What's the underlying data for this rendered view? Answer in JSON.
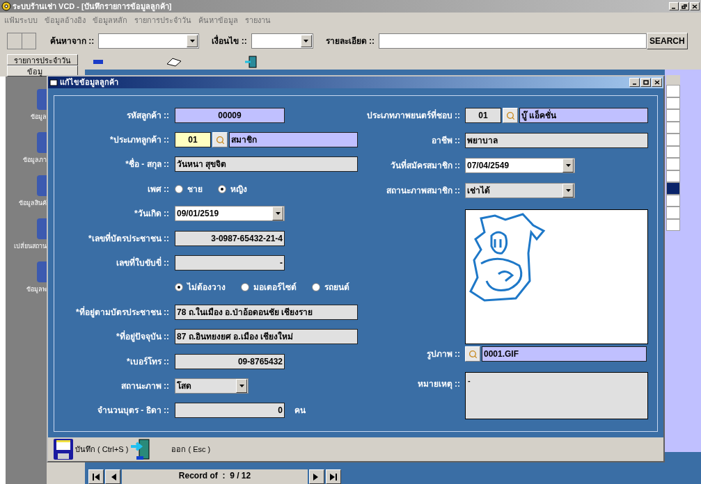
{
  "window": {
    "title": "ระบบร้านเช่า VCD - [บันทึกรายการข้อมูลลูกค้า]"
  },
  "menu": [
    "แฟ้มระบบ",
    "ข้อมูลอ้างอิง",
    "ข้อมูลหลัก",
    "รายการประจำวัน",
    "ค้นหาข้อมูล",
    "รายงาน"
  ],
  "toolbar": {
    "search_from_label": "ค้นหาจาก ::",
    "condition_label": "เงื่อนไข ::",
    "detail_label": "รายละเอียด ::",
    "search_button": "SEARCH"
  },
  "side_tabs": [
    {
      "label": "รายการประจำวัน",
      "selected": false
    },
    {
      "label": "ข้อมู",
      "selected": true
    }
  ],
  "sidebar": {
    "items": [
      "ข้อมูล",
      "ข้อมูลภา",
      "ข้อมูลสินค้",
      "เปลี่ยนสถาน",
      "ข้อมูลพ"
    ]
  },
  "grid": {
    "rows": [
      {
        "selected": false
      },
      {
        "selected": false
      },
      {
        "selected": false
      },
      {
        "selected": false
      },
      {
        "selected": false
      },
      {
        "selected": false
      },
      {
        "selected": false
      },
      {
        "selected": false
      },
      {
        "selected": true
      },
      {
        "selected": false
      },
      {
        "selected": false
      },
      {
        "selected": false
      }
    ]
  },
  "dialog": {
    "title": "แก้ไขข้อมูลลูกค้า",
    "left_fields": [
      {
        "kind": "code",
        "label": "รหัสลูกค้า ::",
        "value": "00009",
        "readonly": true
      },
      {
        "kind": "lookup",
        "label": "*ประเภทลูกค้า ::",
        "code": "01",
        "value": "สมาชิก",
        "focused": true
      },
      {
        "kind": "text",
        "label": "*ชื่อ - สกุล ::",
        "value": "วันหนา สุขจิต"
      },
      {
        "kind": "radio",
        "label": "เพศ ::",
        "options": [
          {
            "label": "ชาย",
            "selected": false
          },
          {
            "label": "หญิง",
            "selected": true
          }
        ]
      },
      {
        "kind": "date",
        "label": "*วันเกิด ::",
        "value": "09/01/2519"
      },
      {
        "kind": "number",
        "label": "*เลขที่บัตรประชาชน ::",
        "value": "3-0987-65432-21-4"
      },
      {
        "kind": "number",
        "label": "เลขที่ใบขับขี่ ::",
        "value": "-"
      },
      {
        "kind": "radio",
        "options": [
          {
            "label": "ไม่ต้องวาง",
            "selected": true
          },
          {
            "label": "มอเตอร์ไซต์",
            "selected": false
          },
          {
            "label": "รถยนต์",
            "selected": false
          }
        ]
      },
      {
        "kind": "text",
        "label": "*ที่อยู่ตามบัตรประชาชน ::",
        "value": "78 ถ.ในเมือง อ.ป่าอ้อดอนชัย เชียงราย"
      },
      {
        "kind": "text",
        "label": "*ที่อยู่ปัจจุบัน ::",
        "value": "87 ถ.อินทยงยศ อ.เมือง เชียงใหม่"
      },
      {
        "kind": "number",
        "label": "*เบอร์โทร ::",
        "value": "09-8765432"
      },
      {
        "kind": "select",
        "label": "สถานะภาพ ::",
        "value": "โสด"
      },
      {
        "kind": "number",
        "label": "จำนวนบุตร - ธิดา ::",
        "value": "0",
        "unit": "คน"
      }
    ],
    "right_fields": [
      {
        "kind": "lookup",
        "label": "ประเภทภาพยนตร์ที่ชอบ ::",
        "code": "01",
        "value": "บู๊ แอ็คชั่น",
        "focused": false
      },
      {
        "kind": "text",
        "label": "อาชีพ ::",
        "value": "พยาบาล"
      },
      {
        "kind": "date",
        "label": "วันที่สมัครสมาชิก ::",
        "value": "07/04/2549"
      },
      {
        "kind": "select",
        "label": "สถานะภาพสมาชิก ::",
        "value": "เช่าได้"
      },
      {
        "kind": "image"
      },
      {
        "kind": "file",
        "label": "รูปภาพ ::",
        "value": "0001.GIF"
      },
      {
        "kind": "memo",
        "label": "หมายเหตุ ::",
        "value": "-"
      }
    ],
    "save_button": "บันทึก ( Ctrl+S )",
    "exit_button": "ออก ( Esc )"
  },
  "navigator": {
    "label": "Record of  :  9 / 12"
  }
}
